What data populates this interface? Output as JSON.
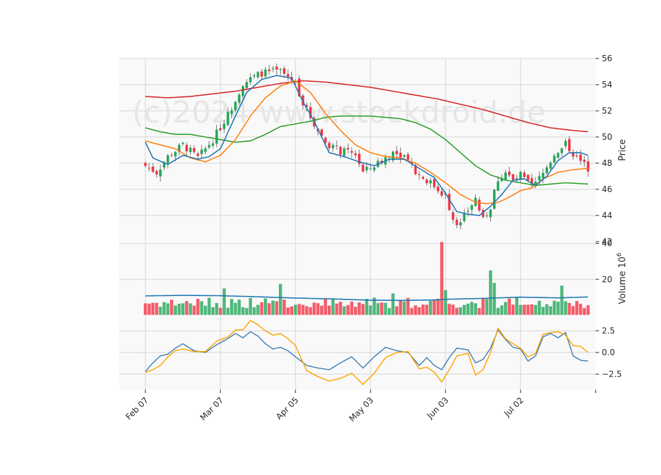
{
  "watermark": "(c)2024 www.stockdroid.de",
  "colors": {
    "up": "#26a65b",
    "down": "#f23645",
    "ma_short": "#1f77b4",
    "ma_mid": "#ff7f0e",
    "ma_long": "#2ca02c",
    "ma_longest": "#d62728",
    "macd": "#4682b4",
    "signal": "#ffa500",
    "volume_ma": "#1f77b4"
  },
  "chart_data": [
    {
      "type": "candlestick",
      "panel": "price",
      "ylabel": "Price",
      "ylim": [
        42,
        56
      ],
      "yticks": [
        42,
        44,
        46,
        48,
        50,
        52,
        54,
        56
      ],
      "xticks": [
        {
          "day": 0,
          "label": "Feb 07"
        },
        {
          "day": 20,
          "label": "Mar 07"
        },
        {
          "day": 40,
          "label": "Apr 05"
        },
        {
          "day": 60,
          "label": "May 03"
        },
        {
          "day": 80,
          "label": "Jun 03"
        },
        {
          "day": 100,
          "label": "Jul 02"
        }
      ],
      "xlim": [
        -7,
        120
      ],
      "anchors": {
        "close": [
          [
            0,
            47.8
          ],
          [
            3,
            47.3
          ],
          [
            6,
            48.5
          ],
          [
            10,
            49.4
          ],
          [
            14,
            48.4
          ],
          [
            18,
            49.8
          ],
          [
            22,
            51.7
          ],
          [
            26,
            54.1
          ],
          [
            31,
            54.9
          ],
          [
            36,
            55.0
          ],
          [
            40,
            54.2
          ],
          [
            42,
            52.6
          ],
          [
            45,
            51.0
          ],
          [
            48,
            49.6
          ],
          [
            52,
            48.9
          ],
          [
            56,
            48.7
          ],
          [
            58,
            47.3
          ],
          [
            62,
            48.0
          ],
          [
            66,
            48.8
          ],
          [
            70,
            48.5
          ],
          [
            72,
            47.3
          ],
          [
            76,
            46.5
          ],
          [
            80,
            45.5
          ],
          [
            82,
            43.8
          ],
          [
            84,
            43.3
          ],
          [
            86,
            44.4
          ],
          [
            88,
            45.3
          ],
          [
            90,
            43.6
          ],
          [
            92,
            44.7
          ],
          [
            94,
            46.8
          ],
          [
            96,
            47.3
          ],
          [
            98,
            46.6
          ],
          [
            100,
            47.1
          ],
          [
            103,
            46.1
          ],
          [
            106,
            47.2
          ],
          [
            109,
            48.7
          ],
          [
            112,
            49.5
          ],
          [
            115,
            48.4
          ],
          [
            118,
            47.6
          ]
        ],
        "ma_short": [
          [
            0,
            49.6
          ],
          [
            2,
            48.4
          ],
          [
            6,
            47.9
          ],
          [
            10,
            48.6
          ],
          [
            14,
            48.3
          ],
          [
            17,
            48.5
          ],
          [
            20,
            49.1
          ],
          [
            24,
            51.6
          ],
          [
            27,
            53.4
          ],
          [
            31,
            54.4
          ],
          [
            35,
            54.7
          ],
          [
            39,
            54.5
          ],
          [
            42,
            52.7
          ],
          [
            45,
            51.2
          ],
          [
            49,
            48.8
          ],
          [
            53,
            48.5
          ],
          [
            57,
            48.1
          ],
          [
            61,
            47.8
          ],
          [
            65,
            48.3
          ],
          [
            69,
            48.3
          ],
          [
            73,
            47.6
          ],
          [
            77,
            46.9
          ],
          [
            80,
            45.7
          ],
          [
            83,
            44.3
          ],
          [
            86,
            44.1
          ],
          [
            89,
            44.0
          ],
          [
            92,
            44.7
          ],
          [
            95,
            45.6
          ],
          [
            98,
            46.7
          ],
          [
            101,
            46.8
          ],
          [
            104,
            46.3
          ],
          [
            107,
            47.0
          ],
          [
            110,
            48.2
          ],
          [
            113,
            48.8
          ],
          [
            116,
            48.8
          ],
          [
            118,
            48.6
          ]
        ],
        "ma_mid": [
          [
            0,
            49.7
          ],
          [
            4,
            49.4
          ],
          [
            8,
            49.1
          ],
          [
            12,
            48.4
          ],
          [
            16,
            48.1
          ],
          [
            20,
            48.6
          ],
          [
            24,
            49.8
          ],
          [
            28,
            51.6
          ],
          [
            32,
            53.0
          ],
          [
            36,
            53.9
          ],
          [
            40,
            54.3
          ],
          [
            44,
            53.4
          ],
          [
            48,
            51.8
          ],
          [
            52,
            50.5
          ],
          [
            56,
            49.4
          ],
          [
            60,
            48.8
          ],
          [
            64,
            48.5
          ],
          [
            68,
            48.4
          ],
          [
            72,
            48.0
          ],
          [
            76,
            47.3
          ],
          [
            80,
            46.5
          ],
          [
            84,
            45.6
          ],
          [
            88,
            45.0
          ],
          [
            91,
            44.9
          ],
          [
            94,
            45.0
          ],
          [
            97,
            45.4
          ],
          [
            100,
            45.9
          ],
          [
            103,
            46.1
          ],
          [
            106,
            46.8
          ],
          [
            110,
            47.3
          ],
          [
            114,
            47.5
          ],
          [
            118,
            47.6
          ]
        ],
        "ma_long": [
          [
            0,
            50.7
          ],
          [
            4,
            50.4
          ],
          [
            8,
            50.2
          ],
          [
            12,
            50.2
          ],
          [
            16,
            50.0
          ],
          [
            20,
            49.8
          ],
          [
            24,
            49.6
          ],
          [
            28,
            49.7
          ],
          [
            32,
            50.2
          ],
          [
            36,
            50.8
          ],
          [
            40,
            51.0
          ],
          [
            44,
            51.2
          ],
          [
            48,
            51.5
          ],
          [
            52,
            51.6
          ],
          [
            56,
            51.6
          ],
          [
            60,
            51.6
          ],
          [
            64,
            51.5
          ],
          [
            68,
            51.4
          ],
          [
            72,
            51.1
          ],
          [
            76,
            50.6
          ],
          [
            80,
            49.8
          ],
          [
            84,
            48.8
          ],
          [
            88,
            47.8
          ],
          [
            92,
            47.1
          ],
          [
            96,
            46.7
          ],
          [
            100,
            46.5
          ],
          [
            104,
            46.3
          ],
          [
            108,
            46.4
          ],
          [
            112,
            46.5
          ],
          [
            118,
            46.4
          ]
        ],
        "ma_longest": [
          [
            0,
            53.1
          ],
          [
            6,
            53.0
          ],
          [
            12,
            53.1
          ],
          [
            18,
            53.3
          ],
          [
            24,
            53.5
          ],
          [
            30,
            53.8
          ],
          [
            36,
            54.1
          ],
          [
            42,
            54.3
          ],
          [
            48,
            54.2
          ],
          [
            54,
            54.0
          ],
          [
            60,
            53.8
          ],
          [
            66,
            53.5
          ],
          [
            72,
            53.2
          ],
          [
            78,
            52.9
          ],
          [
            84,
            52.5
          ],
          [
            90,
            52.1
          ],
          [
            96,
            51.6
          ],
          [
            102,
            51.1
          ],
          [
            108,
            50.7
          ],
          [
            114,
            50.5
          ],
          [
            118,
            50.4
          ]
        ]
      }
    },
    {
      "type": "bar",
      "panel": "volume",
      "ylabel": "Volume",
      "yexponent": "6",
      "ylim": [
        0,
        41
      ],
      "yticks": [
        20,
        40
      ],
      "volume_ma": [
        [
          0,
          10.8
        ],
        [
          10,
          11.1
        ],
        [
          20,
          10.9
        ],
        [
          30,
          10.3
        ],
        [
          40,
          9.6
        ],
        [
          50,
          9.1
        ],
        [
          60,
          8.4
        ],
        [
          70,
          8.3
        ],
        [
          78,
          8.6
        ],
        [
          80,
          8.9
        ],
        [
          90,
          9.4
        ],
        [
          100,
          10.1
        ],
        [
          110,
          9.7
        ],
        [
          118,
          10.2
        ]
      ],
      "spikes": [
        [
          21,
          15.0
        ],
        [
          36,
          17.5
        ],
        [
          66,
          12.2
        ],
        [
          79,
          41.0
        ],
        [
          80,
          14.0
        ],
        [
          92,
          25.0
        ],
        [
          93,
          18.0
        ],
        [
          111,
          16.5
        ]
      ]
    },
    {
      "type": "line",
      "panel": "oscillator",
      "ylim": [
        -4.3,
        4.3
      ],
      "yticks": [
        -2.5,
        0.0,
        2.5
      ],
      "ytick_labels": [
        "−2.5",
        "0.0",
        "2.5"
      ],
      "series": [
        {
          "values": [
            [
              0,
              -2.2
            ],
            [
              2,
              -1.2
            ],
            [
              4,
              -0.4
            ],
            [
              6,
              -0.2
            ],
            [
              8,
              0.5
            ],
            [
              10,
              1.0
            ],
            [
              13,
              0.2
            ],
            [
              16,
              0.0
            ],
            [
              19,
              0.9
            ],
            [
              22,
              1.6
            ],
            [
              24,
              2.2
            ],
            [
              26,
              1.7
            ],
            [
              28,
              2.4
            ],
            [
              30,
              1.9
            ],
            [
              32,
              1.0
            ],
            [
              34,
              0.4
            ],
            [
              36,
              0.6
            ],
            [
              38,
              0.2
            ],
            [
              40,
              -0.5
            ],
            [
              43,
              -1.5
            ],
            [
              46,
              -1.8
            ],
            [
              49,
              -2.0
            ],
            [
              52,
              -1.2
            ],
            [
              55,
              -0.5
            ],
            [
              58,
              -1.8
            ],
            [
              61,
              -0.5
            ],
            [
              64,
              0.6
            ],
            [
              67,
              0.2
            ],
            [
              70,
              0.0
            ],
            [
              73,
              -1.5
            ],
            [
              75,
              -0.6
            ],
            [
              77,
              -1.5
            ],
            [
              79,
              -2.0
            ],
            [
              81,
              -0.6
            ],
            [
              83,
              0.5
            ],
            [
              86,
              0.3
            ],
            [
              88,
              -1.2
            ],
            [
              90,
              -0.8
            ],
            [
              92,
              0.5
            ],
            [
              94,
              2.6
            ],
            [
              96,
              1.5
            ],
            [
              98,
              0.6
            ],
            [
              100,
              0.4
            ],
            [
              102,
              -1.0
            ],
            [
              104,
              -0.4
            ],
            [
              106,
              1.8
            ],
            [
              108,
              2.2
            ],
            [
              110,
              1.7
            ],
            [
              112,
              2.3
            ],
            [
              114,
              -0.4
            ],
            [
              116,
              -0.9
            ],
            [
              118,
              -1.0
            ]
          ]
        },
        {
          "values": [
            [
              0,
              -2.3
            ],
            [
              2,
              -2.0
            ],
            [
              4,
              -1.5
            ],
            [
              6,
              -0.5
            ],
            [
              8,
              0.2
            ],
            [
              10,
              0.4
            ],
            [
              13,
              0.1
            ],
            [
              16,
              0.1
            ],
            [
              19,
              1.3
            ],
            [
              22,
              1.8
            ],
            [
              24,
              2.6
            ],
            [
              26,
              2.6
            ],
            [
              28,
              3.7
            ],
            [
              30,
              3.2
            ],
            [
              32,
              2.5
            ],
            [
              34,
              2.0
            ],
            [
              36,
              2.2
            ],
            [
              38,
              1.6
            ],
            [
              40,
              0.8
            ],
            [
              43,
              -2.1
            ],
            [
              46,
              -2.8
            ],
            [
              49,
              -3.3
            ],
            [
              52,
              -3.0
            ],
            [
              55,
              -2.4
            ],
            [
              58,
              -3.7
            ],
            [
              61,
              -2.4
            ],
            [
              64,
              -0.6
            ],
            [
              67,
              0.0
            ],
            [
              70,
              0.1
            ],
            [
              73,
              -1.9
            ],
            [
              75,
              -1.7
            ],
            [
              77,
              -2.3
            ],
            [
              79,
              -3.4
            ],
            [
              81,
              -2.0
            ],
            [
              83,
              -0.4
            ],
            [
              86,
              -0.1
            ],
            [
              88,
              -2.6
            ],
            [
              90,
              -2.0
            ],
            [
              92,
              0.0
            ],
            [
              94,
              2.8
            ],
            [
              96,
              1.6
            ],
            [
              98,
              1.0
            ],
            [
              100,
              0.5
            ],
            [
              102,
              -0.5
            ],
            [
              104,
              -0.1
            ],
            [
              106,
              2.1
            ],
            [
              108,
              2.3
            ],
            [
              110,
              2.4
            ],
            [
              112,
              2.0
            ],
            [
              114,
              0.8
            ],
            [
              116,
              0.7
            ],
            [
              118,
              0.0
            ]
          ]
        }
      ]
    }
  ]
}
